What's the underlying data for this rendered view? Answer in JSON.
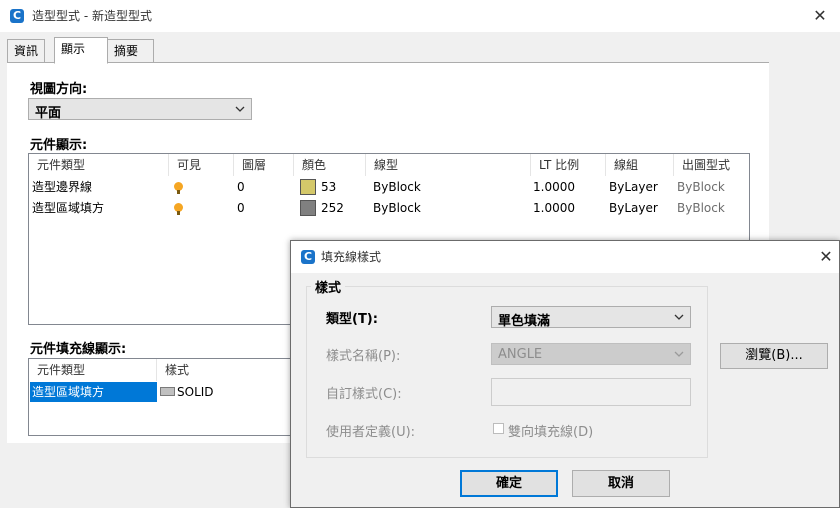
{
  "window": {
    "title": "造型型式 - 新造型型式",
    "close_glyph": "✕",
    "app_glyph": "C"
  },
  "tabs": [
    "資訊",
    "顯示",
    "摘要"
  ],
  "view_direction": {
    "label": "視圖方向:",
    "value": "平面"
  },
  "component_display": {
    "label": "元件顯示:",
    "columns": [
      "元件類型",
      "可見",
      "圖層",
      "顏色",
      "線型",
      "LT 比例",
      "線組",
      "出圖型式"
    ],
    "rows": [
      {
        "type": "造型邊界線",
        "visible": true,
        "layer": "0",
        "color_hex": "#d4c86a",
        "color": "53",
        "linetype": "ByBlock",
        "lt_scale": "1.0000",
        "lineweight": "ByLayer",
        "plot_style": "ByBlock"
      },
      {
        "type": "造型區域填方",
        "visible": true,
        "layer": "0",
        "color_hex": "#808080",
        "color": "252",
        "linetype": "ByBlock",
        "lt_scale": "1.0000",
        "lineweight": "ByLayer",
        "plot_style": "ByBlock"
      }
    ]
  },
  "hatch_display": {
    "label": "元件填充線顯示:",
    "columns": [
      "元件類型",
      "樣式"
    ],
    "rows": [
      {
        "type": "造型區域填方",
        "style": "SOLID"
      }
    ]
  },
  "hatch_dialog": {
    "title": "填充線樣式",
    "close_glyph": "✕",
    "app_glyph": "C",
    "group_label": "樣式",
    "type_label": "類型(T):",
    "type_value": "單色填滿",
    "pattern_name_label": "樣式名稱(P):",
    "pattern_name_value": "ANGLE",
    "custom_pattern_label": "自訂樣式(C):",
    "custom_pattern_value": "",
    "user_defined_label": "使用者定義(U):",
    "double_hatch_label": "雙向填充線(D)",
    "browse_button": "瀏覽(B)...",
    "ok_button": "確定",
    "cancel_button": "取消"
  },
  "colors": {
    "accent": "#0078d7",
    "selection": "#0078d7",
    "bulb": "#f5a623"
  }
}
